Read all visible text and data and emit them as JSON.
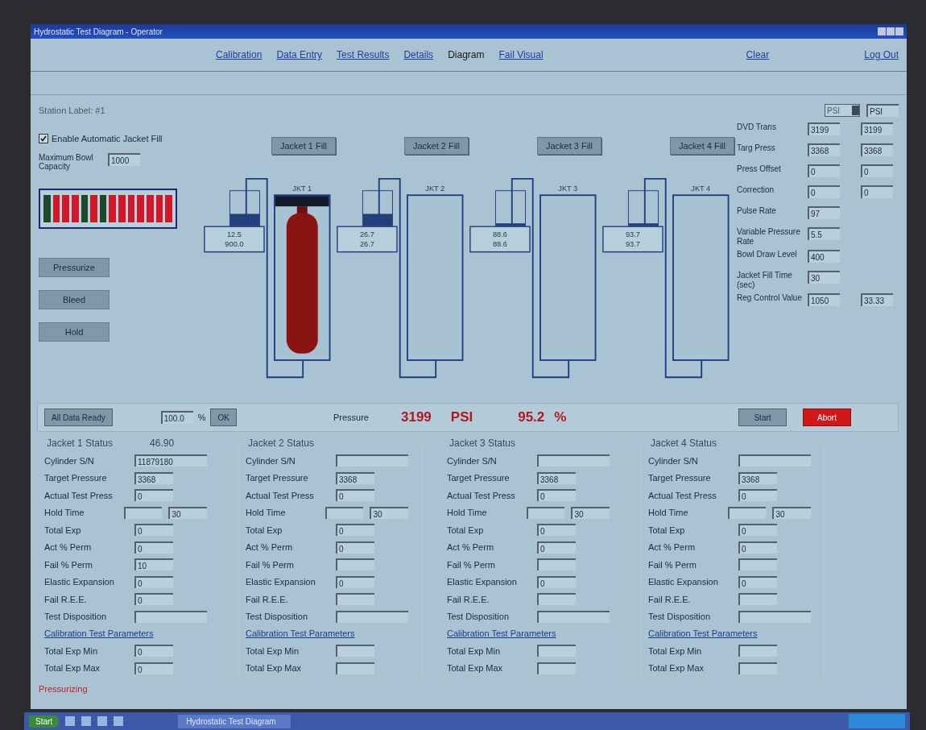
{
  "window": {
    "title": "Hydrostatic Test Diagram - Operator"
  },
  "nav": [
    {
      "label": "Calibration",
      "selected": false
    },
    {
      "label": "Data Entry",
      "selected": false
    },
    {
      "label": "Test Results",
      "selected": false
    },
    {
      "label": "Details",
      "selected": false
    },
    {
      "label": "Diagram",
      "selected": true
    },
    {
      "label": "Fail Visual",
      "selected": false
    }
  ],
  "nav_right": [
    "Clear",
    "Log Out"
  ],
  "station": "Station Label: #1",
  "units": {
    "select": "PSI",
    "field": "PSI"
  },
  "auto_fill": {
    "label": "Enable Automatic Jacket Fill",
    "checked": true
  },
  "bowl_capacity": {
    "label": "Maximum Bowl Capacity",
    "value": "1000"
  },
  "led_bar": [
    {
      "on": true
    },
    {
      "on": false
    },
    {
      "on": false
    },
    {
      "on": false
    },
    {
      "on": true
    },
    {
      "on": false
    },
    {
      "on": true
    },
    {
      "on": false
    },
    {
      "on": false
    },
    {
      "on": false
    },
    {
      "on": false
    },
    {
      "on": false
    },
    {
      "on": false
    },
    {
      "on": false
    }
  ],
  "control_buttons": [
    "Pressurize",
    "Bleed",
    "Hold"
  ],
  "jackets": [
    {
      "fill_button": "Jacket 1 Fill",
      "label": "JKT 1",
      "readings": [
        "12.5",
        "900.0"
      ],
      "level": 0.35,
      "cylinder": true
    },
    {
      "fill_button": "Jacket 2 Fill",
      "label": "JKT 2",
      "readings": [
        "26.7",
        "26.7"
      ],
      "level": 0.35,
      "cylinder": false
    },
    {
      "fill_button": "Jacket 3 Fill",
      "label": "JKT 3",
      "readings": [
        "88.6",
        "88.6"
      ],
      "level": 0.08,
      "cylinder": false
    },
    {
      "fill_button": "Jacket 4 Fill",
      "label": "JKT 4",
      "readings": [
        "93.7",
        "93.7"
      ],
      "level": 0.08,
      "cylinder": false
    }
  ],
  "settings": [
    {
      "label": "DVD Trans",
      "values": [
        "3199",
        "3199"
      ]
    },
    {
      "label": "Targ Press",
      "values": [
        "3368",
        "3368"
      ]
    },
    {
      "label": "Press Offset",
      "values": [
        "0",
        "0"
      ]
    },
    {
      "label": "Correction",
      "values": [
        "0",
        "0"
      ]
    },
    {
      "label": "Pulse Rate",
      "values": [
        "97"
      ]
    },
    {
      "label": "Variable Pressure Rate",
      "values": [
        "5.5"
      ]
    },
    {
      "label": "Bowl Draw Level",
      "values": [
        "400"
      ]
    },
    {
      "label": "Jacket Fill Time (sec)",
      "values": [
        "30"
      ]
    },
    {
      "label": "Reg Control Value",
      "values": [
        "1050",
        "33.33"
      ]
    }
  ],
  "action_bar": {
    "ready_button": "All Data Ready",
    "percent_value": "100.0",
    "percent_unit": "%",
    "ok_button": "OK",
    "pressure_label": "Pressure",
    "pressure_value": "3199",
    "pressure_unit": "PSI",
    "percent_reading": "95.2",
    "percent_reading_unit": "%",
    "start_button": "Start",
    "abort_button": "Abort"
  },
  "status_groups": [
    {
      "title": "Jacket 1 Status",
      "extra": "46.90",
      "rows": [
        {
          "label": "Cylinder S/N",
          "kind": "wide",
          "value": "11879180"
        },
        {
          "label": "Target Pressure",
          "kind": "single",
          "value": "3368"
        },
        {
          "label": "Actual Test Press",
          "kind": "single",
          "value": "0"
        },
        {
          "label": "Hold Time",
          "kind": "split",
          "value": "30"
        },
        {
          "label": "Total Exp",
          "kind": "single",
          "value": "0"
        },
        {
          "label": "Act % Perm",
          "kind": "single",
          "value": "0"
        },
        {
          "label": "Fail % Perm",
          "kind": "single",
          "value": "10"
        },
        {
          "label": "Elastic Expansion",
          "kind": "single",
          "value": "0"
        },
        {
          "label": "Fail R.E.E.",
          "kind": "single",
          "value": "0"
        },
        {
          "label": "Test Disposition",
          "kind": "wide"
        }
      ],
      "link": "Calibration Test Parameters",
      "params": [
        {
          "label": "Total Exp Min",
          "kind": "single",
          "value": "0"
        },
        {
          "label": "Total Exp Max",
          "kind": "single",
          "value": "0"
        }
      ]
    },
    {
      "title": "Jacket 2 Status",
      "rows": [
        {
          "label": "Cylinder S/N",
          "kind": "wide"
        },
        {
          "label": "Target Pressure",
          "kind": "single",
          "value": "3368"
        },
        {
          "label": "Actual Test Press",
          "kind": "single",
          "value": "0"
        },
        {
          "label": "Hold Time",
          "kind": "split",
          "value": "30"
        },
        {
          "label": "Total Exp",
          "kind": "single",
          "value": "0"
        },
        {
          "label": "Act % Perm",
          "kind": "single",
          "value": "0"
        },
        {
          "label": "Fail % Perm",
          "kind": "single"
        },
        {
          "label": "Elastic Expansion",
          "kind": "single",
          "value": "0"
        },
        {
          "label": "Fail R.E.E.",
          "kind": "single"
        },
        {
          "label": "Test Disposition",
          "kind": "wide"
        }
      ],
      "link": "Calibration Test Parameters",
      "params": [
        {
          "label": "Total Exp Min",
          "kind": "single"
        },
        {
          "label": "Total Exp Max",
          "kind": "single"
        }
      ]
    },
    {
      "title": "Jacket 3 Status",
      "rows": [
        {
          "label": "Cylinder S/N",
          "kind": "wide"
        },
        {
          "label": "Target Pressure",
          "kind": "single",
          "value": "3368"
        },
        {
          "label": "Actual Test Press",
          "kind": "single",
          "value": "0"
        },
        {
          "label": "Hold Time",
          "kind": "split",
          "value": "30"
        },
        {
          "label": "Total Exp",
          "kind": "single",
          "value": "0"
        },
        {
          "label": "Act % Perm",
          "kind": "single",
          "value": "0"
        },
        {
          "label": "Fail % Perm",
          "kind": "single"
        },
        {
          "label": "Elastic Expansion",
          "kind": "single",
          "value": "0"
        },
        {
          "label": "Fail R.E.E.",
          "kind": "single"
        },
        {
          "label": "Test Disposition",
          "kind": "wide"
        }
      ],
      "link": "Calibration Test Parameters",
      "params": [
        {
          "label": "Total Exp Min",
          "kind": "single"
        },
        {
          "label": "Total Exp Max",
          "kind": "single"
        }
      ]
    },
    {
      "title": "Jacket 4 Status",
      "rows": [
        {
          "label": "Cylinder S/N",
          "kind": "wide"
        },
        {
          "label": "Target Pressure",
          "kind": "single",
          "value": "3368"
        },
        {
          "label": "Actual Test Press",
          "kind": "single",
          "value": "0"
        },
        {
          "label": "Hold Time",
          "kind": "split",
          "value": "30"
        },
        {
          "label": "Total Exp",
          "kind": "single",
          "value": "0"
        },
        {
          "label": "Act % Perm",
          "kind": "single",
          "value": "0"
        },
        {
          "label": "Fail % Perm",
          "kind": "single"
        },
        {
          "label": "Elastic Expansion",
          "kind": "single",
          "value": "0"
        },
        {
          "label": "Fail R.E.E.",
          "kind": "single"
        },
        {
          "label": "Test Disposition",
          "kind": "wide"
        }
      ],
      "link": "Calibration Test Parameters",
      "params": [
        {
          "label": "Total Exp Min",
          "kind": "single"
        },
        {
          "label": "Total Exp Max",
          "kind": "single"
        }
      ]
    }
  ],
  "status_message": "Pressurizing",
  "taskbar": {
    "start": "Start",
    "task": "Hydrostatic Test Diagram"
  }
}
